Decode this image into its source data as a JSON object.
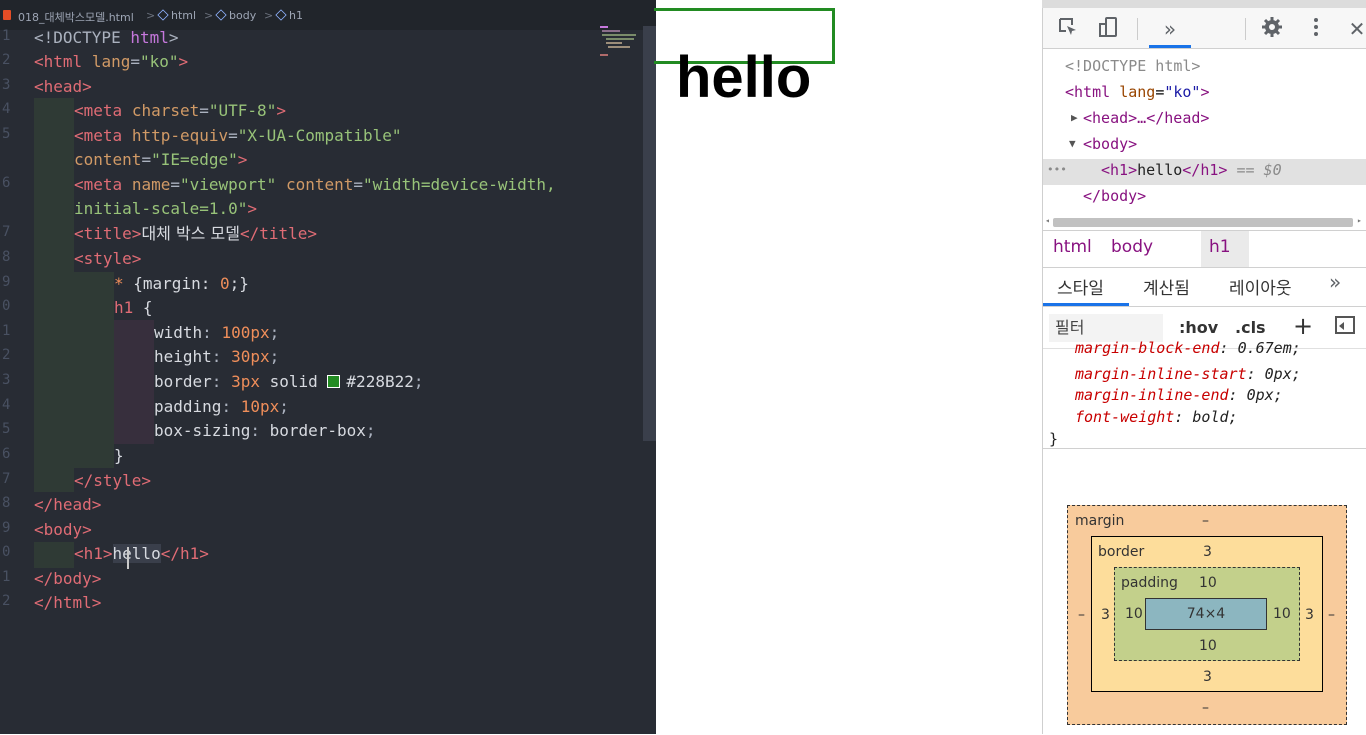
{
  "editor": {
    "breadcrumb": {
      "file": "018_대체박스모델.html",
      "items": [
        "html",
        "body",
        "h1"
      ]
    },
    "line_numbers": [
      "1",
      "2",
      "3",
      "4",
      "5",
      "",
      "6",
      "",
      "7",
      "8",
      "9",
      "0",
      "1",
      "2",
      "3",
      "4",
      "5",
      "6",
      "7",
      "8",
      "9",
      "0",
      "1",
      "2"
    ],
    "code": {
      "l1_doctype": "<!DOCTYPE",
      "l1_html": "html",
      "l1_close": ">",
      "l2_open": "<html",
      "l2_attr": "lang",
      "l2_val": "\"ko\"",
      "l3": "<head>",
      "l4_tag": "<meta",
      "l4_attr": "charset",
      "l4_val": "\"UTF-8\"",
      "l5_tag": "<meta",
      "l5_attr": "http-equiv",
      "l5_val": "\"X-UA-Compatible\"",
      "l5b_attr": "content",
      "l5b_val": "\"IE=edge\"",
      "l6_tag": "<meta",
      "l6_attr1": "name",
      "l6_val1": "\"viewport\"",
      "l6_attr2": "content",
      "l6_val2": "\"width=device-width,",
      "l6b_val": "initial-scale=1.0\"",
      "l7_open": "<title>",
      "l7_text": "대체 박스 모델",
      "l7_close": "</title>",
      "l8": "<style>",
      "l9_sel": "*",
      "l9_rule": " {margin: ",
      "l9_num": "0",
      "l9_end": ";}",
      "l10_sel": "h1",
      "l10_brace": " {",
      "l11_prop": "width",
      "l11_val": "100px",
      "l12_prop": "height",
      "l12_val": "30px",
      "l13_prop": "border",
      "l13_num": "3px",
      "l13_kw": "solid",
      "l13_color": "#228B22",
      "l14_prop": "padding",
      "l14_val": "10px",
      "l15_prop": "box-sizing",
      "l15_val": "border-box",
      "l16": "}",
      "l17": "</style>",
      "l18": "</head>",
      "l19": "<body>",
      "l20_open": "<h1>",
      "l20_text": "hello",
      "l20_close": "</h1>",
      "l21": "</body>",
      "l22": "</html>"
    }
  },
  "viewport": {
    "heading": "hello",
    "h1_border_color": "#228B22"
  },
  "devtools": {
    "toolbar": {
      "inspect_icon": "inspect-cursor-icon",
      "device_icon": "device-toggle-icon",
      "more_tabs": "»",
      "settings_icon": "gear-icon",
      "menu_icon": "kebab-menu-icon",
      "close": "✕"
    },
    "elements": {
      "doctype": "<!DOCTYPE html>",
      "html_tag": "<html",
      "html_attr": "lang",
      "html_val": "\"ko\"",
      "html_close": ">",
      "head": "<head>…</head>",
      "body_open": "<body>",
      "h1_open": "<h1>",
      "h1_text": "hello",
      "h1_close": "</h1>",
      "selected_marker": "== $0",
      "dots": "•••",
      "body_close": "</body>"
    },
    "breadcrumbs": [
      "html",
      "body",
      "h1"
    ],
    "tabs": [
      "스타일",
      "계산됨",
      "레이아웃",
      "»"
    ],
    "filter": {
      "placeholder": "필터",
      "hov": ":hov",
      "cls": ".cls",
      "plus": "+"
    },
    "styles": [
      {
        "prop": "margin-block-end",
        "value": "0.67em;"
      },
      {
        "prop": "margin-inline-start",
        "value": "0px;"
      },
      {
        "prop": "margin-inline-end",
        "value": "0px;"
      },
      {
        "prop": "font-weight",
        "value": "bold;"
      }
    ],
    "styles_close": "}",
    "box_model": {
      "margin_label": "margin",
      "margin_top": "–",
      "margin_bottom": "–",
      "margin_left": "–",
      "margin_right": "–",
      "border_label": "border",
      "border_top": "3",
      "border_bottom": "3",
      "border_left": "3",
      "border_right": "3",
      "padding_label": "padding",
      "padding_top": "10",
      "padding_bottom": "10",
      "padding_left": "10",
      "padding_right": "10",
      "content": "74×4",
      "colors": {
        "margin": "#f8cb9c",
        "border": "#fddd9b",
        "padding": "#c3d08b",
        "content": "#8cb6c0"
      }
    }
  }
}
